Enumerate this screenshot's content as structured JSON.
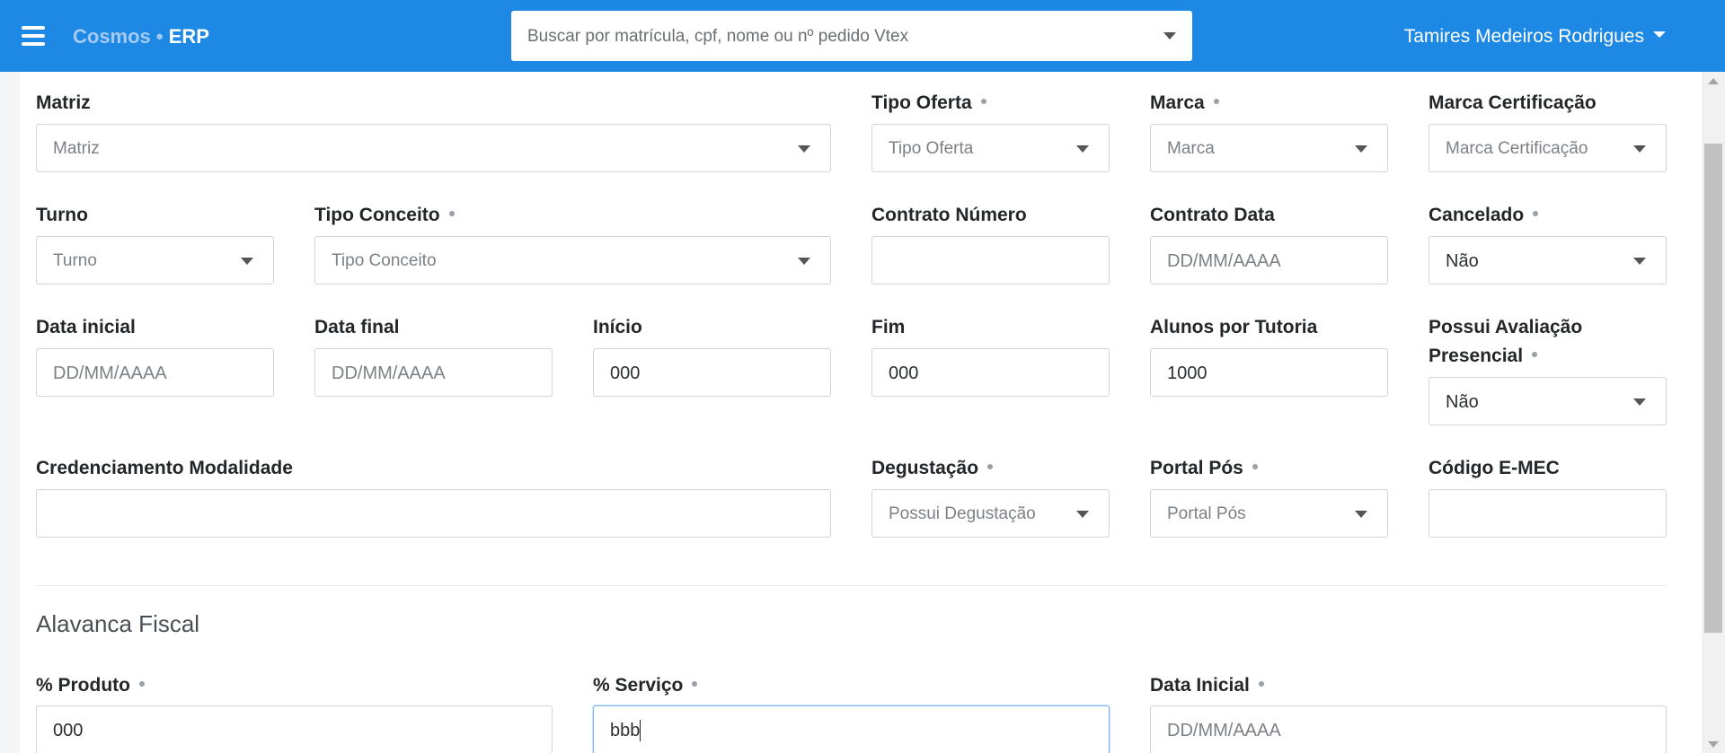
{
  "header": {
    "brand_part1": "Cosmos",
    "brand_sep": " • ",
    "brand_part2": "ERP",
    "search_placeholder": "Buscar por matrícula, cpf, nome ou nº pedido Vtex",
    "user_name": "Tamires Medeiros Rodrigues"
  },
  "colors": {
    "topbar": "#1e88e5",
    "brand_light": "#a6cbf3"
  },
  "icons": {
    "menu": "hamburger-menu-icon",
    "dropdown": "chevron-down-icon",
    "required": "required-dot-icon"
  },
  "form": {
    "matriz": {
      "label": "Matriz",
      "placeholder": "Matriz"
    },
    "tipo_oferta": {
      "label": "Tipo Oferta",
      "placeholder": "Tipo Oferta"
    },
    "marca": {
      "label": "Marca",
      "placeholder": "Marca"
    },
    "marca_certificacao": {
      "label": "Marca Certificação",
      "placeholder": "Marca Certificação"
    },
    "turno": {
      "label": "Turno",
      "placeholder": "Turno"
    },
    "tipo_conceito": {
      "label": "Tipo Conceito",
      "placeholder": "Tipo Conceito"
    },
    "contrato_numero": {
      "label": "Contrato Número",
      "value": ""
    },
    "contrato_data": {
      "label": "Contrato Data",
      "placeholder": "DD/MM/AAAA"
    },
    "cancelado": {
      "label": "Cancelado",
      "value": "Não"
    },
    "data_inicial": {
      "label": "Data inicial",
      "placeholder": "DD/MM/AAAA"
    },
    "data_final": {
      "label": "Data final",
      "placeholder": "DD/MM/AAAA"
    },
    "inicio": {
      "label": "Início",
      "value": "000"
    },
    "fim": {
      "label": "Fim",
      "value": "000"
    },
    "alunos_por_tutoria": {
      "label": "Alunos por Tutoria",
      "value": "1000"
    },
    "possui_avaliacao_presencial": {
      "label": "Possui Avaliação Presencial",
      "value": "Não"
    },
    "credenciamento_modalidade": {
      "label": "Credenciamento Modalidade",
      "value": ""
    },
    "degustacao": {
      "label": "Degustação",
      "placeholder": "Possui Degustação"
    },
    "portal_pos": {
      "label": "Portal Pós",
      "placeholder": "Portal Pós"
    },
    "codigo_emec": {
      "label": "Código E-MEC",
      "value": ""
    }
  },
  "alavanca": {
    "title": "Alavanca Fiscal",
    "produto": {
      "label": "% Produto",
      "value": "000"
    },
    "servico": {
      "label": "% Serviço",
      "value": "bbb"
    },
    "data_inicial": {
      "label": "Data Inicial",
      "placeholder": "DD/MM/AAAA"
    }
  }
}
